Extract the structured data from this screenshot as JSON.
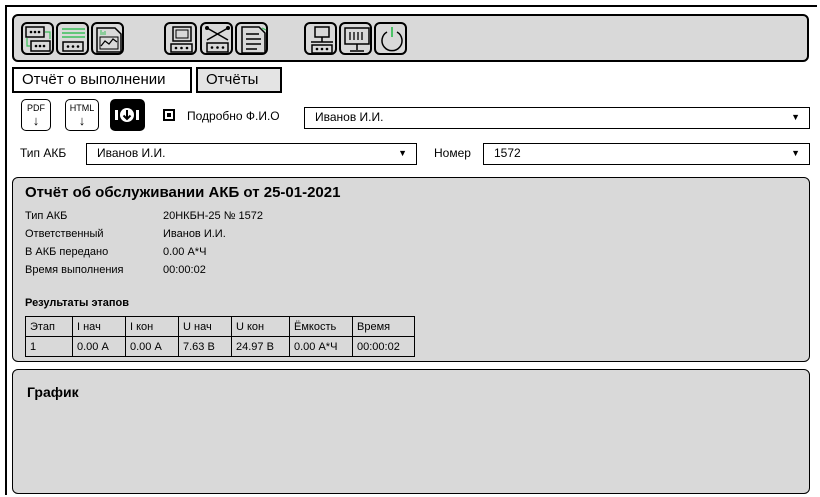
{
  "toolbar": {
    "buttons": [
      {
        "name": "batteries-chain-icon",
        "highlight_color": "#3bbf5a"
      },
      {
        "name": "battery-list-icon",
        "highlight_color": "#3bbf5a"
      },
      {
        "name": "chart-document-icon",
        "highlight_color": "#3bbf5a"
      },
      {
        "name": "battery-monitor-icon"
      },
      {
        "name": "battery-network-icon"
      },
      {
        "name": "report-document-icon",
        "highlight_color": "#3bbf5a"
      },
      {
        "name": "device-connection-icon"
      },
      {
        "name": "monitor-icon"
      },
      {
        "name": "power-icon",
        "highlight_color": "#3bbf5a"
      }
    ]
  },
  "tabs": [
    {
      "label": "Отчёт о выполнении",
      "active": true
    },
    {
      "label": "Отчёты",
      "active": false
    }
  ],
  "export": {
    "pdf_label": "PDF",
    "html_label": "HTML",
    "detailed_label": "Подробно Ф.И.О",
    "detailed_checked": true,
    "person_select": "Иванов И.И."
  },
  "filters": {
    "battery_type_label": "Тип АКБ",
    "battery_type_value": "Иванов И.И.",
    "number_label": "Номер",
    "number_value": "1572"
  },
  "report": {
    "title": "Отчёт об обслуживании АКБ от 25-01-2021",
    "fields": [
      {
        "key": "Тип АКБ",
        "value": "20НКБН-25 № 1572"
      },
      {
        "key": "Ответственный",
        "value": "Иванов И.И."
      },
      {
        "key": "В АКБ передано",
        "value": "0.00 А*Ч"
      },
      {
        "key": "Время выполнения",
        "value": "00:00:02"
      }
    ],
    "stages_title": "Результаты этапов",
    "table": {
      "headers": [
        "Этап",
        "I нач",
        "I кон",
        "U нач",
        "U кон",
        "Ёмкость",
        "Время"
      ],
      "rows": [
        [
          "1",
          "0.00 А",
          "0.00 А",
          "7.63 В",
          "24.97 В",
          "0.00 А*Ч",
          "00:00:02"
        ]
      ]
    }
  },
  "graph": {
    "title": "График"
  },
  "colors": {
    "panel": "#d9d9d9",
    "accent_green": "#3bbf5a"
  }
}
